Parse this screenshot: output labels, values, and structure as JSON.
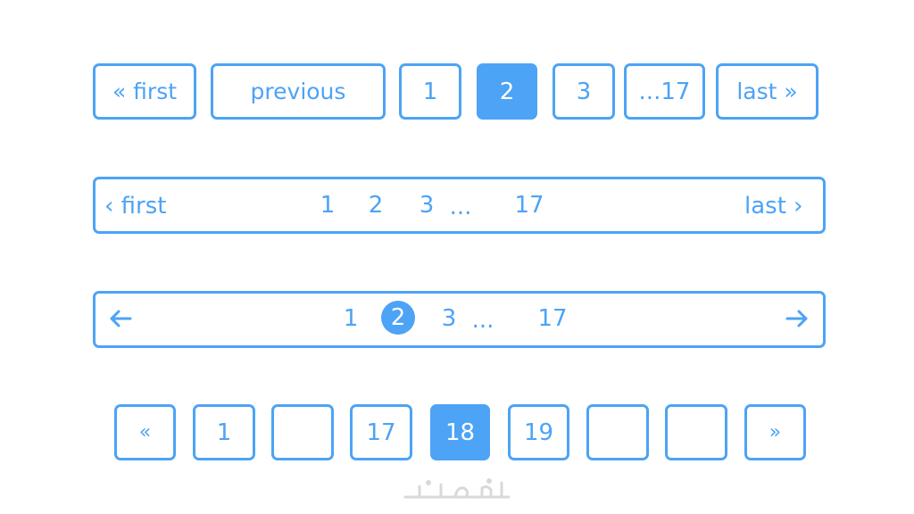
{
  "row1": {
    "first": "« first",
    "previous": "previous",
    "pages": [
      "1",
      "2",
      "3",
      "...17"
    ],
    "active": "2",
    "last": "last »"
  },
  "row2": {
    "first": "‹ first",
    "pages": [
      "1",
      "2",
      "3",
      "...",
      "17"
    ],
    "last": "last ›"
  },
  "row3": {
    "prev_icon": "arrow-left-icon",
    "pages": [
      "1",
      "2",
      "3",
      "...",
      "17"
    ],
    "active": "2",
    "next_icon": "arrow-right-icon"
  },
  "row4": {
    "prev": "«",
    "pages": [
      "1",
      "",
      "17",
      "18",
      "19",
      "",
      ""
    ],
    "active": "18",
    "next": "»"
  },
  "watermark": {
    "text": "خمسات"
  },
  "colors": {
    "accent": "#4da3f5",
    "background": "#ffffff"
  }
}
